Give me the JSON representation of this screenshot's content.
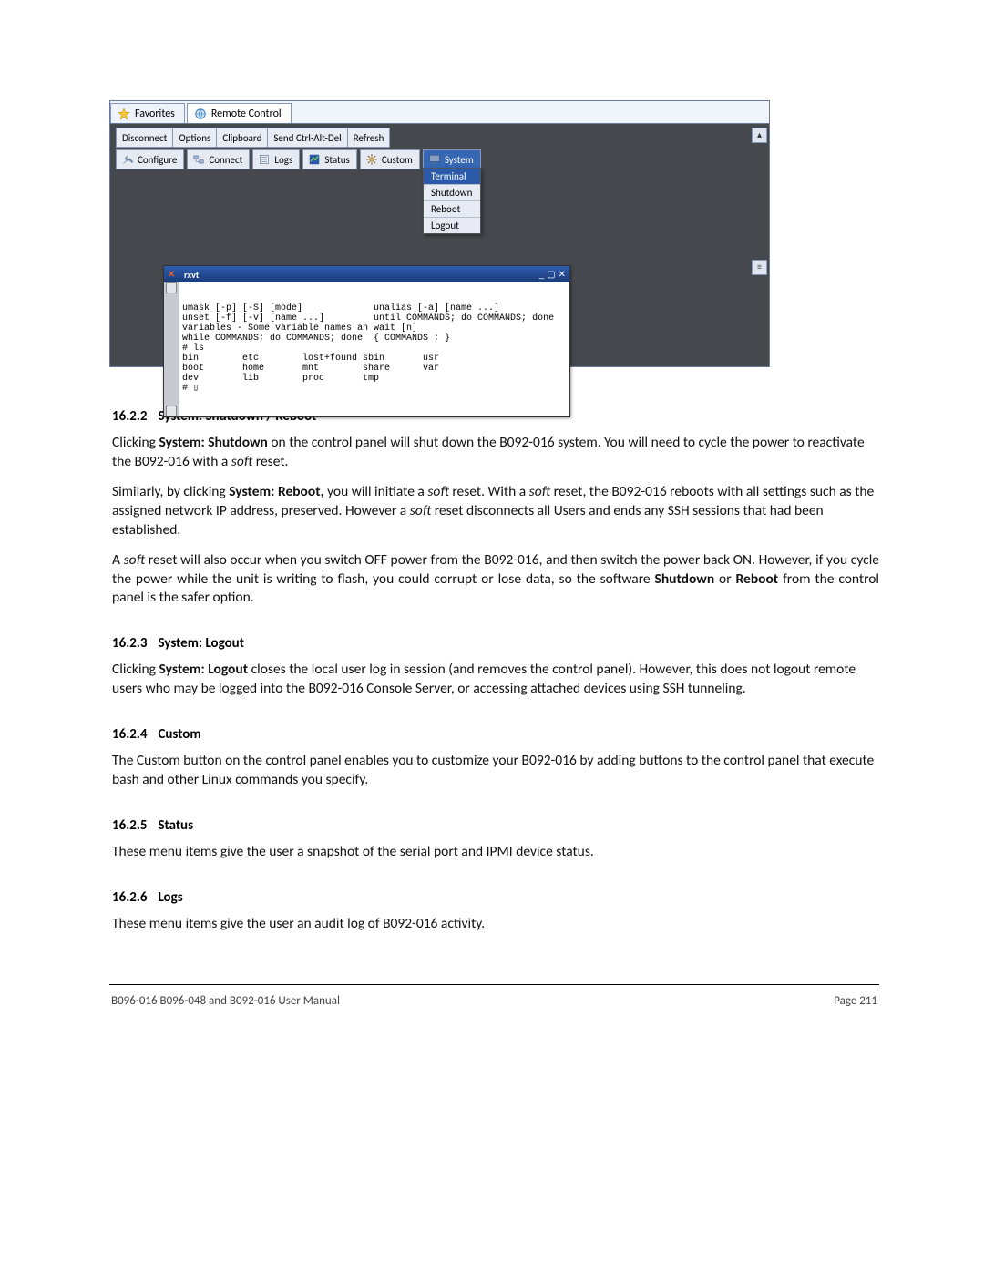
{
  "tabs": {
    "favorites": "Favorites",
    "remote": "Remote Control"
  },
  "toolbar1": {
    "disconnect": "Disconnect",
    "options": "Options",
    "clipboard": "Clipboard",
    "send_cad": "Send Ctrl-Alt-Del",
    "refresh": "Refresh"
  },
  "toolbar2": {
    "configure": "Configure",
    "connect": "Connect",
    "logs": "Logs",
    "status": "Status",
    "custom": "Custom",
    "system": "System"
  },
  "dropdown": {
    "terminal": "Terminal",
    "shutdown": "Shutdown",
    "reboot": "Reboot",
    "logout": "Logout"
  },
  "terminal": {
    "title": "rxvt",
    "content": "umask [-p] [-S] [mode]             unalias [-a] [name ...]\nunset [-f] [-v] [name ...]         until COMMANDS; do COMMANDS; done\nvariables - Some variable names an wait [n]\nwhile COMMANDS; do COMMANDS; done  { COMMANDS ; }\n# ls\nbin        etc        lost+found sbin       usr\nboot       home       mnt        share      var\ndev        lib        proc       tmp\n# ▯"
  },
  "sections": {
    "s1622": {
      "num": "16.2.2",
      "title": "System: Shutdown / Reboot",
      "p1a": "Clicking ",
      "p1b": "System: Shutdown",
      "p1c": " on the control panel will shut down the B092-016 system. You will need to cycle the power to reactivate the B092-016 with a ",
      "p1d": "soft",
      "p1e": " reset.",
      "p2a": "Similarly, by clicking ",
      "p2b": "System: Reboot,",
      "p2c": " you will initiate a ",
      "p2d": "soft",
      "p2e": " reset. With a ",
      "p2f": "soft",
      "p2g": " reset, the B092-016 reboots with all settings such as the assigned network IP address, preserved. However a ",
      "p2h": "soft",
      "p2i": " reset disconnects all Users and ends any SSH sessions that had been established.",
      "p3a": "A ",
      "p3b": "soft",
      "p3c": " reset will also occur when you switch OFF power from the B092-016, and then switch the power back ON. However, if you cycle the power while the unit is writing to flash, you could corrupt or lose data, so the software ",
      "p3d": "Shutdown",
      "p3e": " or ",
      "p3f": "Reboot",
      "p3g": " from the control panel is the safer option."
    },
    "s1623": {
      "num": "16.2.3",
      "title": "System: Logout",
      "p1a": "Clicking ",
      "p1b": "System: Logout",
      "p1c": " closes the local user log in session (and removes the control panel). However, this does not logout remote users who may be logged into the B092-016 Console Server, or accessing attached devices using SSH tunneling."
    },
    "s1624": {
      "num": "16.2.4",
      "title": "Custom",
      "p1": "The Custom button on the control panel enables you to customize your B092-016 by adding buttons to the control panel that execute bash and other Linux commands you specify."
    },
    "s1625": {
      "num": "16.2.5",
      "title": "Status",
      "p1": "These menu items give the user a snapshot of the serial port and IPMI device status."
    },
    "s1626": {
      "num": "16.2.6",
      "title": "Logs",
      "p1": "These menu items give the user an audit log of B092-016 activity."
    }
  },
  "footer": {
    "left": "B096-016 B096-048 and B092-016 User Manual",
    "right": "Page 211"
  }
}
